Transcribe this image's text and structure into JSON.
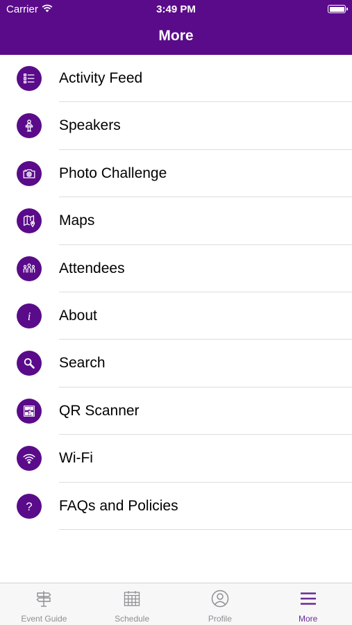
{
  "status_bar": {
    "carrier": "Carrier",
    "time": "3:49 PM"
  },
  "nav": {
    "title": "More"
  },
  "colors": {
    "accent": "#5a0b8a",
    "tab_active": "#6a2a96",
    "tab_inactive": "#8e8e93"
  },
  "menu": {
    "items": [
      {
        "label": "Activity Feed",
        "icon": "activity-feed-icon"
      },
      {
        "label": "Speakers",
        "icon": "speaker-podium-icon"
      },
      {
        "label": "Photo Challenge",
        "icon": "camera-icon"
      },
      {
        "label": "Maps",
        "icon": "map-icon"
      },
      {
        "label": "Attendees",
        "icon": "attendees-icon"
      },
      {
        "label": "About",
        "icon": "info-icon"
      },
      {
        "label": "Search",
        "icon": "search-icon"
      },
      {
        "label": "QR Scanner",
        "icon": "qr-code-icon"
      },
      {
        "label": "Wi-Fi",
        "icon": "wifi-icon"
      },
      {
        "label": "FAQs and Policies",
        "icon": "question-icon"
      }
    ]
  },
  "tabs": [
    {
      "label": "Event Guide",
      "icon": "signpost-icon",
      "active": false
    },
    {
      "label": "Schedule",
      "icon": "calendar-icon",
      "active": false
    },
    {
      "label": "Profile",
      "icon": "profile-icon",
      "active": false
    },
    {
      "label": "More",
      "icon": "menu-icon",
      "active": true
    }
  ]
}
